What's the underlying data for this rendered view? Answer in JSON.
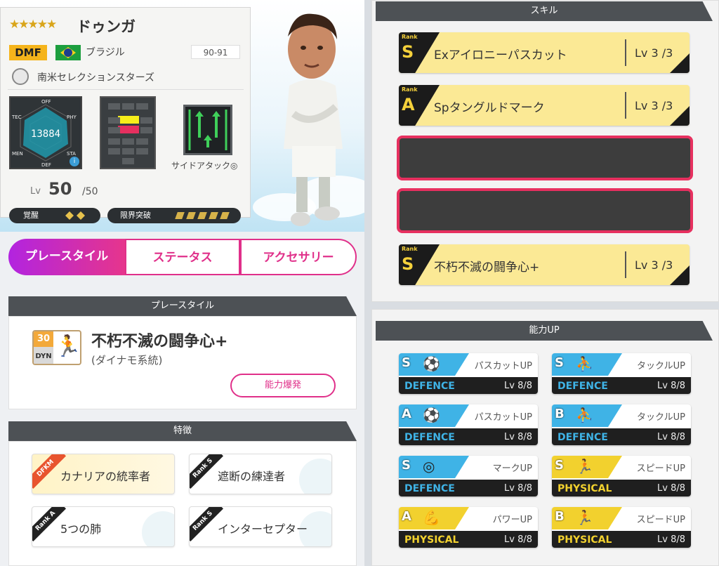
{
  "player": {
    "stars": "★★★★★",
    "name": "ドゥンガ",
    "position": "DMF",
    "nation": "ブラジル",
    "era": "90-91",
    "team": "南米セレクションスターズ",
    "radar": {
      "top": "OFF",
      "tec": "TEC",
      "phy": "PHY",
      "men": "MEN",
      "sta": "STA",
      "def": "DEF",
      "value": "13884"
    },
    "side_attack": "サイドアタック◎",
    "level_label": "Lv",
    "level": "50",
    "level_max": "/50",
    "awaken_label": "覚醒",
    "limit_label": "限界突破"
  },
  "tabs": [
    "プレースタイル",
    "ステータス",
    "アクセサリー"
  ],
  "playstyle": {
    "header": "プレースタイル",
    "badge_num": "30",
    "badge_code": "DYN",
    "name": "不朽不滅の闘争心+",
    "sub": "(ダイナモ系統)",
    "button": "能力爆発"
  },
  "traits": {
    "header": "特徴",
    "items": [
      {
        "ribbon": "DFKM",
        "label": "カナリアの統率者",
        "ribbon_color": "#e8542e"
      },
      {
        "ribbon": "Rank S",
        "label": "遮断の練達者",
        "ribbon_color": "#222222"
      },
      {
        "ribbon": "Rank A",
        "label": "5つの肺",
        "ribbon_color": "#222222"
      },
      {
        "ribbon": "Rank S",
        "label": "インターセプター",
        "ribbon_color": "#222222"
      }
    ]
  },
  "skills": {
    "header": "スキル",
    "rank_word": "Rank",
    "items": [
      {
        "rank": "S",
        "name": "Exアイロニーパスカット",
        "lv": "Lv 3 /3"
      },
      {
        "rank": "A",
        "name": "Spタングルドマーク",
        "lv": "Lv 3 /3"
      },
      {
        "rank": "S",
        "name": "不朽不滅の闘争心+",
        "lv": "Lv 3 /3"
      }
    ]
  },
  "abilities": {
    "header": "能力UP",
    "items": [
      {
        "rank": "S",
        "name": "パスカットUP",
        "cat": "DEFENCE",
        "lv": "Lv 8/8",
        "icon": "⚽",
        "color": "#3fb3e6"
      },
      {
        "rank": "S",
        "name": "タックルUP",
        "cat": "DEFENCE",
        "lv": "Lv 8/8",
        "icon": "⛹",
        "color": "#3fb3e6"
      },
      {
        "rank": "A",
        "name": "パスカットUP",
        "cat": "DEFENCE",
        "lv": "Lv 8/8",
        "icon": "⚽",
        "color": "#3fb3e6"
      },
      {
        "rank": "B",
        "name": "タックルUP",
        "cat": "DEFENCE",
        "lv": "Lv 8/8",
        "icon": "⛹",
        "color": "#3fb3e6"
      },
      {
        "rank": "S",
        "name": "マークUP",
        "cat": "DEFENCE",
        "lv": "Lv 8/8",
        "icon": "◎",
        "color": "#3fb3e6"
      },
      {
        "rank": "S",
        "name": "スピードUP",
        "cat": "PHYSICAL",
        "lv": "Lv 8/8",
        "icon": "🏃",
        "color": "#f2d12e"
      },
      {
        "rank": "A",
        "name": "パワーUP",
        "cat": "PHYSICAL",
        "lv": "Lv 8/8",
        "icon": "💪",
        "color": "#f2d12e"
      },
      {
        "rank": "B",
        "name": "スピードUP",
        "cat": "PHYSICAL",
        "lv": "Lv 8/8",
        "icon": "🏃",
        "color": "#f2d12e"
      }
    ]
  }
}
